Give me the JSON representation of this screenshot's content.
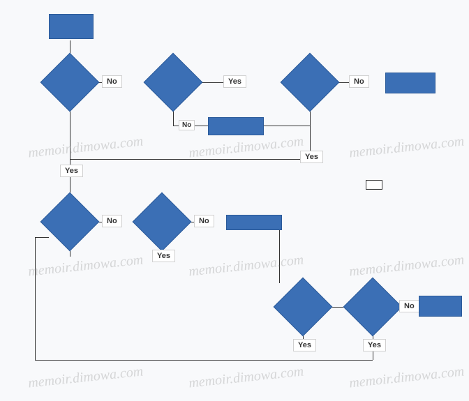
{
  "diagram": {
    "type": "flowchart",
    "start": {
      "text": ""
    },
    "decisions": {
      "d1": {
        "text": ""
      },
      "d2": {
        "text": ""
      },
      "d3": {
        "text": ""
      },
      "d4": {
        "text": ""
      },
      "d5": {
        "text": ""
      },
      "d6": {
        "text": ""
      },
      "d7": {
        "text": ""
      }
    },
    "processes": {
      "p1": {
        "text": ""
      },
      "p2": {
        "text": ""
      },
      "p3": {
        "text": ""
      },
      "p4": {
        "text": ""
      }
    },
    "labels": {
      "no": "No",
      "yes": "Yes"
    },
    "watermark": "memoir.dimowa.com"
  }
}
